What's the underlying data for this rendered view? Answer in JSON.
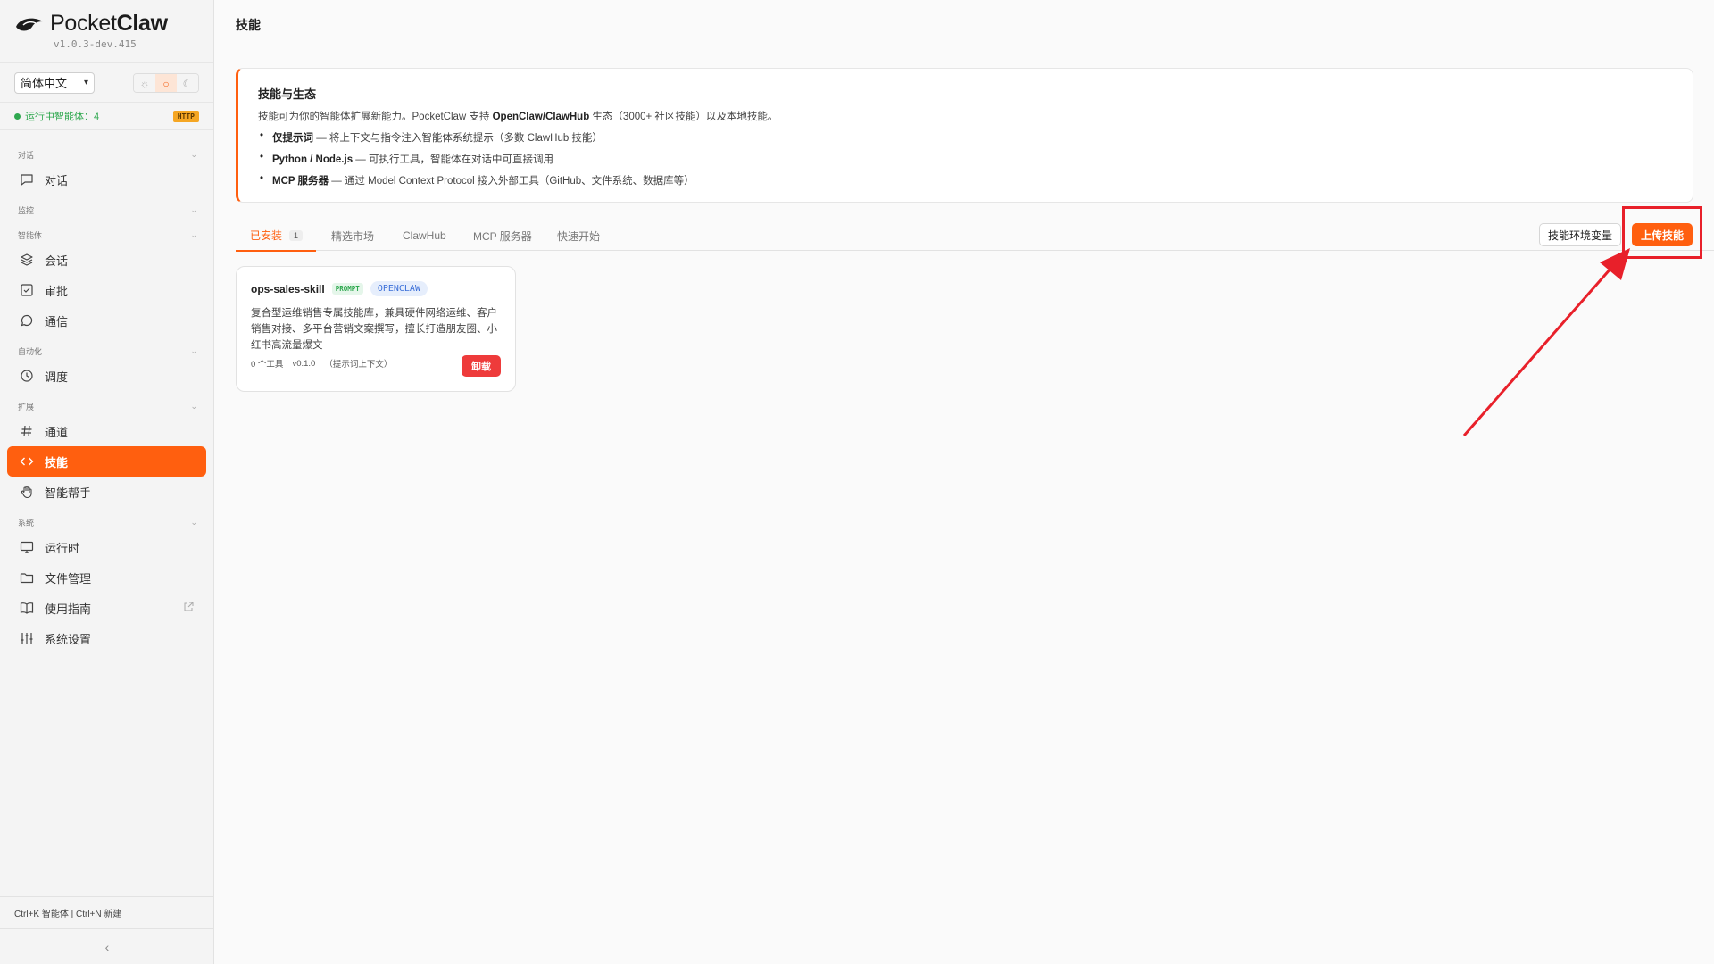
{
  "brand": {
    "name_light": "Pocket",
    "name_bold": "Claw",
    "version": "v1.0.3-dev.415"
  },
  "lang_select": {
    "value": "简体中文"
  },
  "theme": {
    "options": [
      "sun-icon",
      "auto-icon",
      "moon-icon"
    ],
    "active": "auto-icon"
  },
  "status": {
    "text": "运行中智能体：4",
    "badge": "HTTP"
  },
  "nav": {
    "sections": [
      {
        "label": "对话",
        "items": [
          {
            "label": "对话",
            "icon": "chat-icon"
          }
        ]
      },
      {
        "label": "监控",
        "items": []
      },
      {
        "label": "智能体",
        "items": [
          {
            "label": "会话",
            "icon": "layers-icon"
          },
          {
            "label": "审批",
            "icon": "check-square-icon"
          },
          {
            "label": "通信",
            "icon": "message-circle-icon"
          }
        ]
      },
      {
        "label": "自动化",
        "items": [
          {
            "label": "调度",
            "icon": "clock-icon"
          }
        ]
      },
      {
        "label": "扩展",
        "items": [
          {
            "label": "通道",
            "icon": "hash-icon"
          },
          {
            "label": "技能",
            "icon": "code-icon",
            "active": true
          },
          {
            "label": "智能帮手",
            "icon": "hand-icon"
          }
        ]
      },
      {
        "label": "系统",
        "items": [
          {
            "label": "运行时",
            "icon": "monitor-icon"
          },
          {
            "label": "文件管理",
            "icon": "folder-icon"
          },
          {
            "label": "使用指南",
            "icon": "book-icon",
            "external": true
          },
          {
            "label": "系统设置",
            "icon": "sliders-icon"
          }
        ]
      }
    ]
  },
  "shortcut_hint": "Ctrl+K 智能体 | Ctrl+N 新建",
  "page_title": "技能",
  "info": {
    "title": "技能与生态",
    "desc_prefix": "技能可为你的智能体扩展新能力。PocketClaw 支持 ",
    "desc_bold": "OpenClaw/ClawHub",
    "desc_suffix": " 生态（3000+ 社区技能）以及本地技能。",
    "items": [
      {
        "bold": "仅提示词",
        "text": " — 将上下文与指令注入智能体系统提示（多数 ClawHub 技能）"
      },
      {
        "bold": "Python / Node.js",
        "text": " — 可执行工具，智能体在对话中可直接调用"
      },
      {
        "bold": "MCP 服务器",
        "text": " — 通过 Model Context Protocol 接入外部工具（GitHub、文件系统、数据库等）"
      }
    ]
  },
  "tabs": [
    {
      "label": "已安装",
      "count": "1",
      "active": true
    },
    {
      "label": "精选市场"
    },
    {
      "label": "ClawHub"
    },
    {
      "label": "MCP 服务器"
    },
    {
      "label": "快速开始"
    }
  ],
  "actions": {
    "env_vars": "技能环境变量",
    "upload": "上传技能"
  },
  "skills": [
    {
      "name": "ops-sales-skill",
      "badge_type": "PROMPT",
      "badge_source": "OPENCLAW",
      "description": "复合型运维销售专属技能库，兼具硬件网络运维、客户销售对接、多平台营销文案撰写，擅长打造朋友圈、小红书高流量爆文",
      "tools": "0 个工具",
      "version": "v0.1.0",
      "mode": "（提示词上下文）",
      "uninstall": "卸载"
    }
  ],
  "colors": {
    "accent": "#ff5f0f",
    "danger": "#ee3b3b",
    "highlight": "#e8202a",
    "success": "#2fa84f"
  }
}
